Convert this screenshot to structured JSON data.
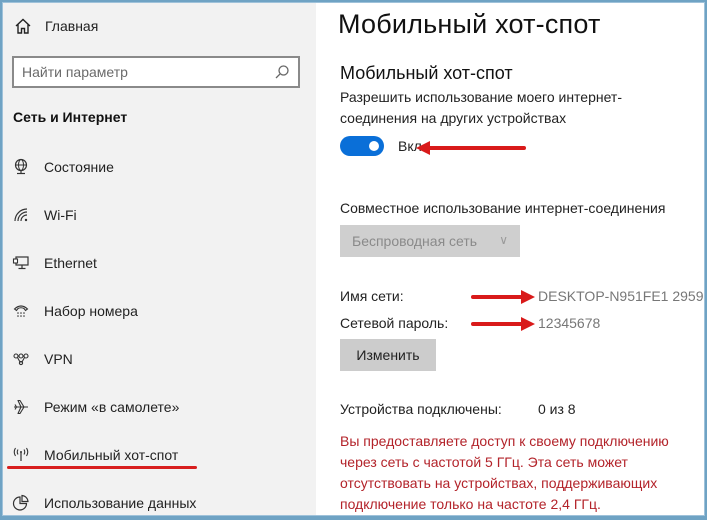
{
  "sidebar": {
    "home_label": "Главная",
    "search_placeholder": "Найти параметр",
    "section_title": "Сеть и Интернет",
    "items": [
      {
        "label": "Состояние",
        "icon": "globe-monitor-icon"
      },
      {
        "label": "Wi-Fi",
        "icon": "wifi-icon"
      },
      {
        "label": "Ethernet",
        "icon": "ethernet-icon"
      },
      {
        "label": "Набор номера",
        "icon": "dialup-phone-icon"
      },
      {
        "label": "VPN",
        "icon": "vpn-icon"
      },
      {
        "label": "Режим «в самолете»",
        "icon": "airplane-icon"
      },
      {
        "label": "Мобильный хот-спот",
        "icon": "hotspot-icon",
        "selected": true
      },
      {
        "label": "Использование данных",
        "icon": "pie-chart-icon"
      }
    ]
  },
  "main": {
    "page_title": "Мобильный хот-спот",
    "sub_title": "Мобильный хот-спот",
    "description": "Разрешить использование моего интернет-соединения на других устройствах",
    "toggle": {
      "state_label": "Вкл.",
      "on": true,
      "color": "#0a6fd8"
    },
    "share_label": "Совместное использование интернет-соединения",
    "share_dropdown": {
      "selected": "Беспроводная сеть",
      "disabled": true
    },
    "network_name_label": "Имя сети:",
    "network_name_value": "DESKTOP-N951FE1 2959",
    "password_label": "Сетевой пароль:",
    "password_value": "12345678",
    "change_button": "Изменить",
    "devices_label": "Устройства подключены:",
    "devices_value": "0 из 8",
    "warning_text": "Вы предоставляете доступ к своему подключению через сеть с частотой 5 ГГц. Эта сеть может отсутствовать на устройствах, поддерживающих подключение только на частоте 2,4 ГГц.",
    "warning_color": "#b3232a"
  },
  "annotations": {
    "arrow_color": "#d91a1a"
  }
}
